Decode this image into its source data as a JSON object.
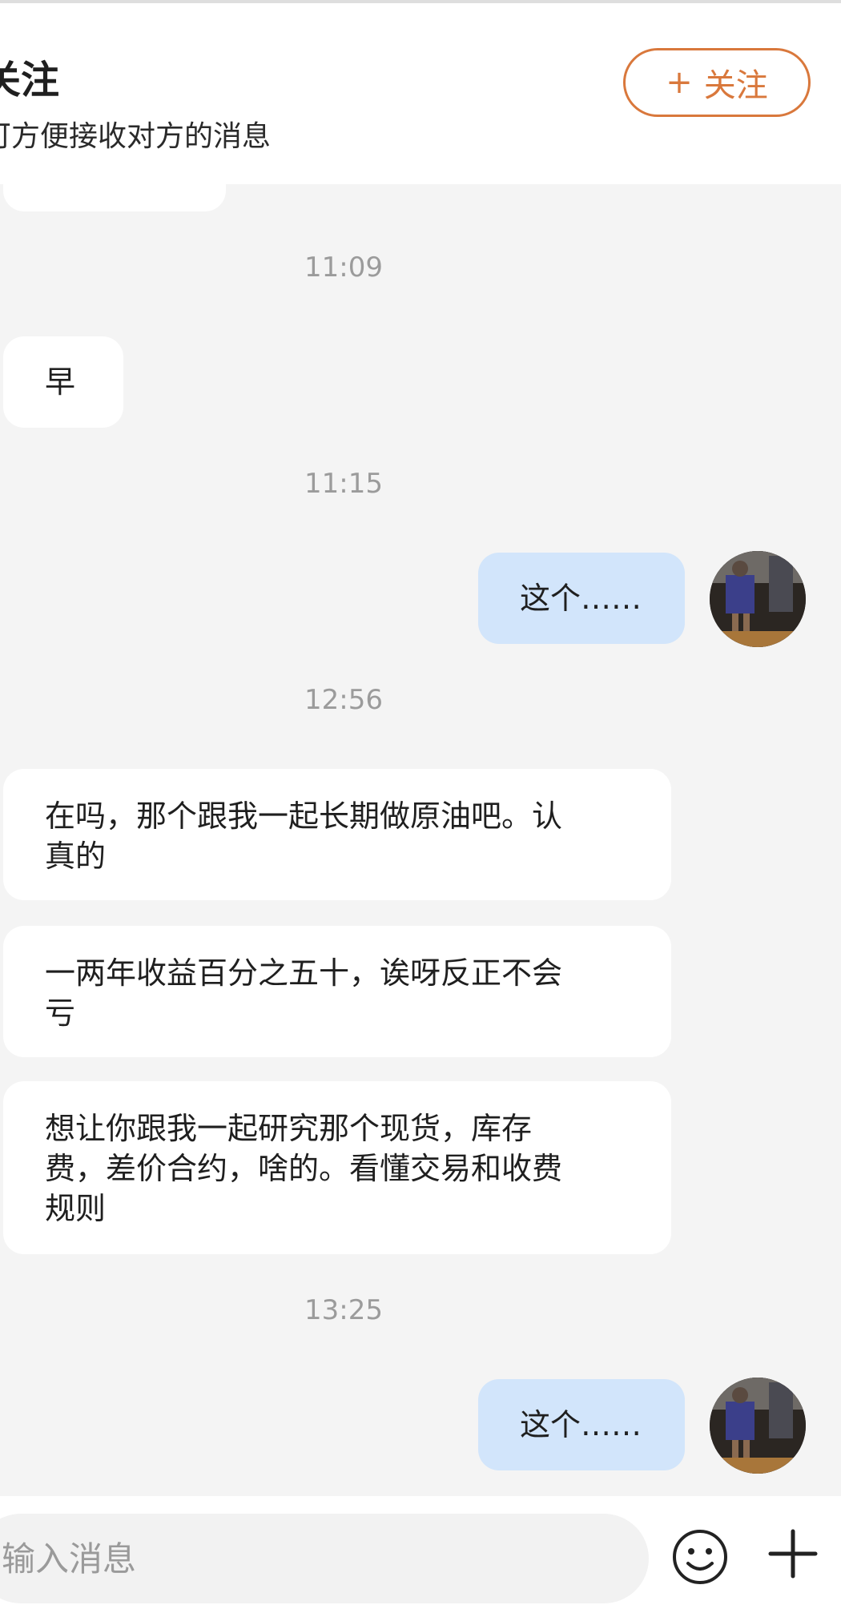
{
  "banner": {
    "title": "关注",
    "subtitle": "可方便接收对方的消息",
    "follow_button": {
      "icon": "plus-icon",
      "label": "关注"
    }
  },
  "messages": [
    {
      "kind": "time",
      "text": "11:09"
    },
    {
      "kind": "incoming",
      "text": "早"
    },
    {
      "kind": "time",
      "text": "11:15"
    },
    {
      "kind": "outgoing",
      "text": "这个……"
    },
    {
      "kind": "time",
      "text": "12:56"
    },
    {
      "kind": "incoming",
      "text": "在吗，那个跟我一起长期做原油吧。认\n真的"
    },
    {
      "kind": "incoming",
      "text": "一两年收益百分之五十，诶呀反正不会\n亏"
    },
    {
      "kind": "incoming",
      "text": "想让你跟我一起研究那个现货，库存\n费，差价合约，啥的。看懂交易和收费\n规则"
    },
    {
      "kind": "time",
      "text": "13:25"
    },
    {
      "kind": "outgoing",
      "text": "这个……"
    }
  ],
  "input_bar": {
    "placeholder": "输入消息",
    "emoji_icon": "smiley-icon",
    "add_icon": "plus-icon"
  },
  "colors": {
    "accent": "#d9783c",
    "outgoing_bubble": "#d2e5fb",
    "incoming_bubble": "#ffffff",
    "chat_background": "#f4f4f4",
    "timestamp": "#9b9b9b"
  }
}
